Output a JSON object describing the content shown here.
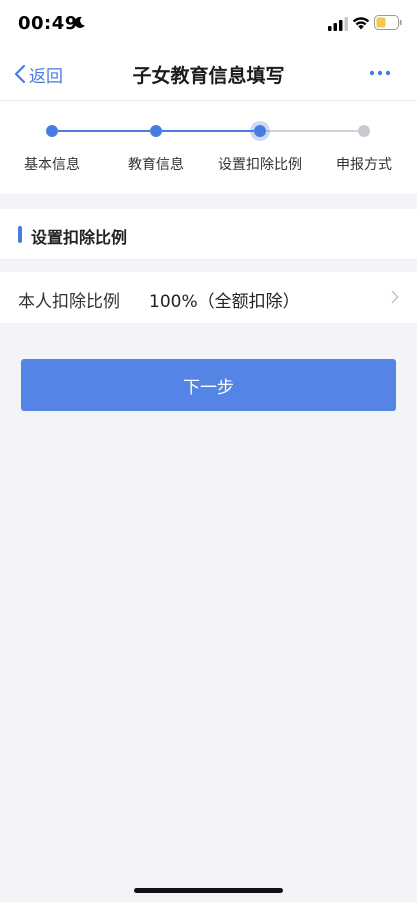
{
  "status_bar": {
    "time": "00:49",
    "icons": [
      "moon-icon",
      "signal-icon",
      "wifi-icon",
      "battery-icon"
    ],
    "battery_color": "#f2c94c"
  },
  "nav": {
    "back_label": "返回",
    "title": "子女教育信息填写",
    "more_icon": "more-icon"
  },
  "steps": {
    "items": [
      {
        "label": "基本信息",
        "state": "done"
      },
      {
        "label": "教育信息",
        "state": "done"
      },
      {
        "label": "设置扣除比例",
        "state": "current"
      },
      {
        "label": "申报方式",
        "state": "todo"
      }
    ]
  },
  "section": {
    "title": "设置扣除比例"
  },
  "deduction_row": {
    "label": "本人扣除比例",
    "value": "100%（全额扣除）"
  },
  "next_button": {
    "label": "下一步"
  },
  "colors": {
    "accent": "#4a7be0",
    "button": "#5384e6",
    "background": "#f3f4f8",
    "inactive": "#c9cad0"
  }
}
